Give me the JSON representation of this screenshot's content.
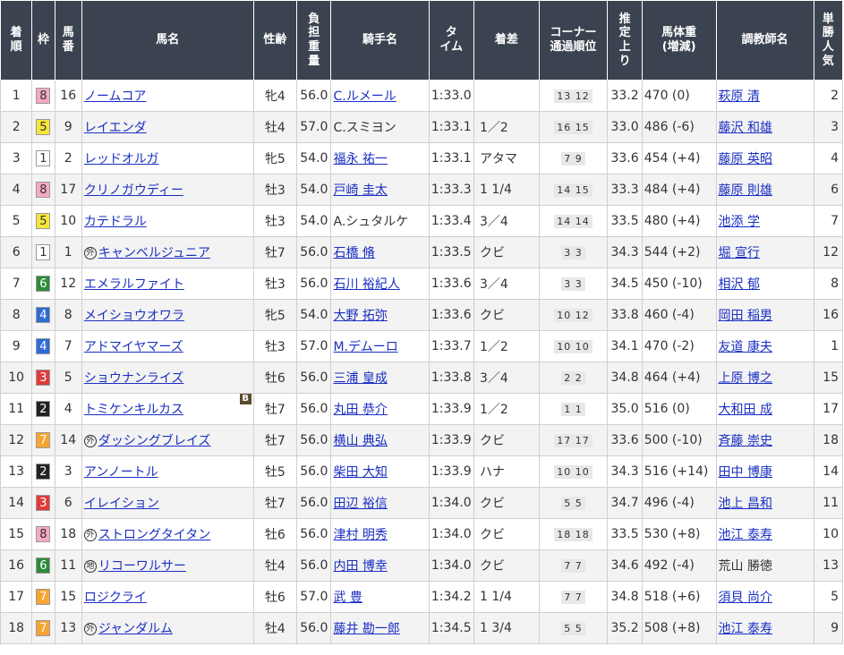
{
  "headers": {
    "rank": "着順",
    "waku": "枠",
    "umaban": "馬番",
    "horse": "馬名",
    "sexage": "性齢",
    "weight": "負担重量",
    "jockey": "騎手名",
    "time": "タイム",
    "margin": "着差",
    "corner": "コーナー通過順位",
    "last3f": "推定上り",
    "bodyweight": "馬体重(増減)",
    "trainer": "調教師名",
    "pop": "単勝人気"
  },
  "waku_colors": {
    "1": {
      "bg": "#ffffff",
      "fg": "#333333"
    },
    "2": {
      "bg": "#222222",
      "fg": "#ffffff"
    },
    "3": {
      "bg": "#e03a3a",
      "fg": "#ffffff"
    },
    "4": {
      "bg": "#2f6bd4",
      "fg": "#ffffff"
    },
    "5": {
      "bg": "#f5e637",
      "fg": "#333333"
    },
    "6": {
      "bg": "#2e8b3a",
      "fg": "#ffffff"
    },
    "7": {
      "bg": "#f7a531",
      "fg": "#ffffff"
    },
    "8": {
      "bg": "#f5a9c5",
      "fg": "#333333"
    }
  },
  "rows": [
    {
      "rank": "1",
      "waku": "8",
      "umaban": "16",
      "mark": "",
      "horse": "ノームコア",
      "blinker": "",
      "sexage": "牝4",
      "weight": "56.0",
      "jockey": "C.ルメール",
      "jockey_link": true,
      "time": "1:33.0",
      "margin": "",
      "corner": "13 12",
      "last3f": "33.2",
      "bodyweight": "470 (0)",
      "trainer": "萩原 清",
      "trainer_link": true,
      "pop": "2"
    },
    {
      "rank": "2",
      "waku": "5",
      "umaban": "9",
      "mark": "",
      "horse": "レイエンダ",
      "blinker": "",
      "sexage": "牡4",
      "weight": "57.0",
      "jockey": "C.スミヨン",
      "jockey_link": false,
      "time": "1:33.1",
      "margin": "1／2",
      "corner": "16 15",
      "last3f": "33.0",
      "bodyweight": "486 (-6)",
      "trainer": "藤沢 和雄",
      "trainer_link": true,
      "pop": "3"
    },
    {
      "rank": "3",
      "waku": "1",
      "umaban": "2",
      "mark": "",
      "horse": "レッドオルガ",
      "blinker": "",
      "sexage": "牝5",
      "weight": "54.0",
      "jockey": "福永 祐一",
      "jockey_link": true,
      "time": "1:33.1",
      "margin": "アタマ",
      "corner": "7 9",
      "last3f": "33.6",
      "bodyweight": "454 (+4)",
      "trainer": "藤原 英昭",
      "trainer_link": true,
      "pop": "4"
    },
    {
      "rank": "4",
      "waku": "8",
      "umaban": "17",
      "mark": "",
      "horse": "クリノガウディー",
      "blinker": "",
      "sexage": "牡3",
      "weight": "54.0",
      "jockey": "戸崎 圭太",
      "jockey_link": true,
      "time": "1:33.3",
      "margin": "1 1/4",
      "corner": "14 15",
      "last3f": "33.3",
      "bodyweight": "484 (+4)",
      "trainer": "藤原 則雄",
      "trainer_link": true,
      "pop": "6"
    },
    {
      "rank": "5",
      "waku": "5",
      "umaban": "10",
      "mark": "",
      "horse": "カテドラル",
      "blinker": "",
      "sexage": "牡3",
      "weight": "54.0",
      "jockey": "A.シュタルケ",
      "jockey_link": false,
      "time": "1:33.4",
      "margin": "3／4",
      "corner": "14 14",
      "last3f": "33.5",
      "bodyweight": "480 (+4)",
      "trainer": "池添 学",
      "trainer_link": true,
      "pop": "7"
    },
    {
      "rank": "6",
      "waku": "1",
      "umaban": "1",
      "mark": "外",
      "horse": "キャンベルジュニア",
      "blinker": "",
      "sexage": "牡7",
      "weight": "56.0",
      "jockey": "石橋 脩",
      "jockey_link": true,
      "time": "1:33.5",
      "margin": "クビ",
      "corner": "3 3",
      "last3f": "34.3",
      "bodyweight": "544 (+2)",
      "trainer": "堀 宣行",
      "trainer_link": true,
      "pop": "12"
    },
    {
      "rank": "7",
      "waku": "6",
      "umaban": "12",
      "mark": "",
      "horse": "エメラルファイト",
      "blinker": "",
      "sexage": "牡3",
      "weight": "56.0",
      "jockey": "石川 裕紀人",
      "jockey_link": true,
      "time": "1:33.6",
      "margin": "3／4",
      "corner": "3 3",
      "last3f": "34.5",
      "bodyweight": "450 (-10)",
      "trainer": "相沢 郁",
      "trainer_link": true,
      "pop": "8"
    },
    {
      "rank": "8",
      "waku": "4",
      "umaban": "8",
      "mark": "",
      "horse": "メイショウオワラ",
      "blinker": "",
      "sexage": "牝5",
      "weight": "54.0",
      "jockey": "大野 拓弥",
      "jockey_link": true,
      "time": "1:33.6",
      "margin": "クビ",
      "corner": "10 12",
      "last3f": "33.8",
      "bodyweight": "460 (-4)",
      "trainer": "岡田 稲男",
      "trainer_link": true,
      "pop": "16"
    },
    {
      "rank": "9",
      "waku": "4",
      "umaban": "7",
      "mark": "",
      "horse": "アドマイヤマーズ",
      "blinker": "",
      "sexage": "牡3",
      "weight": "57.0",
      "jockey": "M.デムーロ",
      "jockey_link": true,
      "time": "1:33.7",
      "margin": "1／2",
      "corner": "10 10",
      "last3f": "34.1",
      "bodyweight": "470 (-2)",
      "trainer": "友道 康夫",
      "trainer_link": true,
      "pop": "1"
    },
    {
      "rank": "10",
      "waku": "3",
      "umaban": "5",
      "mark": "",
      "horse": "ショウナンライズ",
      "blinker": "",
      "sexage": "牡6",
      "weight": "56.0",
      "jockey": "三浦 皇成",
      "jockey_link": true,
      "time": "1:33.8",
      "margin": "3／4",
      "corner": "2 2",
      "last3f": "34.8",
      "bodyweight": "464 (+4)",
      "trainer": "上原 博之",
      "trainer_link": true,
      "pop": "15"
    },
    {
      "rank": "11",
      "waku": "2",
      "umaban": "4",
      "mark": "",
      "horse": "トミケンキルカス",
      "blinker": "B",
      "sexage": "牡7",
      "weight": "56.0",
      "jockey": "丸田 恭介",
      "jockey_link": true,
      "time": "1:33.9",
      "margin": "1／2",
      "corner": "1 1",
      "last3f": "35.0",
      "bodyweight": "516 (0)",
      "trainer": "大和田 成",
      "trainer_link": true,
      "pop": "17"
    },
    {
      "rank": "12",
      "waku": "7",
      "umaban": "14",
      "mark": "外",
      "horse": "ダッシングブレイズ",
      "blinker": "",
      "sexage": "牡7",
      "weight": "56.0",
      "jockey": "横山 典弘",
      "jockey_link": true,
      "time": "1:33.9",
      "margin": "クビ",
      "corner": "17 17",
      "last3f": "33.6",
      "bodyweight": "500 (-10)",
      "trainer": "斉藤 崇史",
      "trainer_link": true,
      "pop": "18"
    },
    {
      "rank": "13",
      "waku": "2",
      "umaban": "3",
      "mark": "",
      "horse": "アンノートル",
      "blinker": "",
      "sexage": "牡5",
      "weight": "56.0",
      "jockey": "柴田 大知",
      "jockey_link": true,
      "time": "1:33.9",
      "margin": "ハナ",
      "corner": "10 10",
      "last3f": "34.3",
      "bodyweight": "516 (+14)",
      "trainer": "田中 博康",
      "trainer_link": true,
      "pop": "14"
    },
    {
      "rank": "14",
      "waku": "3",
      "umaban": "6",
      "mark": "",
      "horse": "イレイション",
      "blinker": "",
      "sexage": "牡7",
      "weight": "56.0",
      "jockey": "田辺 裕信",
      "jockey_link": true,
      "time": "1:34.0",
      "margin": "クビ",
      "corner": "5 5",
      "last3f": "34.7",
      "bodyweight": "496 (-4)",
      "trainer": "池上 昌和",
      "trainer_link": true,
      "pop": "11"
    },
    {
      "rank": "15",
      "waku": "8",
      "umaban": "18",
      "mark": "外",
      "horse": "ストロングタイタン",
      "blinker": "",
      "sexage": "牡6",
      "weight": "56.0",
      "jockey": "津村 明秀",
      "jockey_link": true,
      "time": "1:34.0",
      "margin": "クビ",
      "corner": "18 18",
      "last3f": "33.5",
      "bodyweight": "530 (+8)",
      "trainer": "池江 泰寿",
      "trainer_link": true,
      "pop": "10"
    },
    {
      "rank": "16",
      "waku": "6",
      "umaban": "11",
      "mark": "地",
      "horse": "リコーワルサー",
      "blinker": "",
      "sexage": "牡4",
      "weight": "56.0",
      "jockey": "内田 博幸",
      "jockey_link": true,
      "time": "1:34.0",
      "margin": "クビ",
      "corner": "7 7",
      "last3f": "34.6",
      "bodyweight": "492 (-4)",
      "trainer": "荒山 勝徳",
      "trainer_link": false,
      "pop": "13"
    },
    {
      "rank": "17",
      "waku": "7",
      "umaban": "15",
      "mark": "",
      "horse": "ロジクライ",
      "blinker": "",
      "sexage": "牡6",
      "weight": "57.0",
      "jockey": "武 豊",
      "jockey_link": true,
      "time": "1:34.2",
      "margin": "1 1/4",
      "corner": "7 7",
      "last3f": "34.8",
      "bodyweight": "518 (+6)",
      "trainer": "須貝 尚介",
      "trainer_link": true,
      "pop": "5"
    },
    {
      "rank": "18",
      "waku": "7",
      "umaban": "13",
      "mark": "外",
      "horse": "ジャンダルム",
      "blinker": "",
      "sexage": "牡4",
      "weight": "56.0",
      "jockey": "藤井 勘一郎",
      "jockey_link": true,
      "time": "1:34.5",
      "margin": "1 3/4",
      "corner": "5 5",
      "last3f": "35.2",
      "bodyweight": "508 (+8)",
      "trainer": "池江 泰寿",
      "trainer_link": true,
      "pop": "9"
    }
  ]
}
